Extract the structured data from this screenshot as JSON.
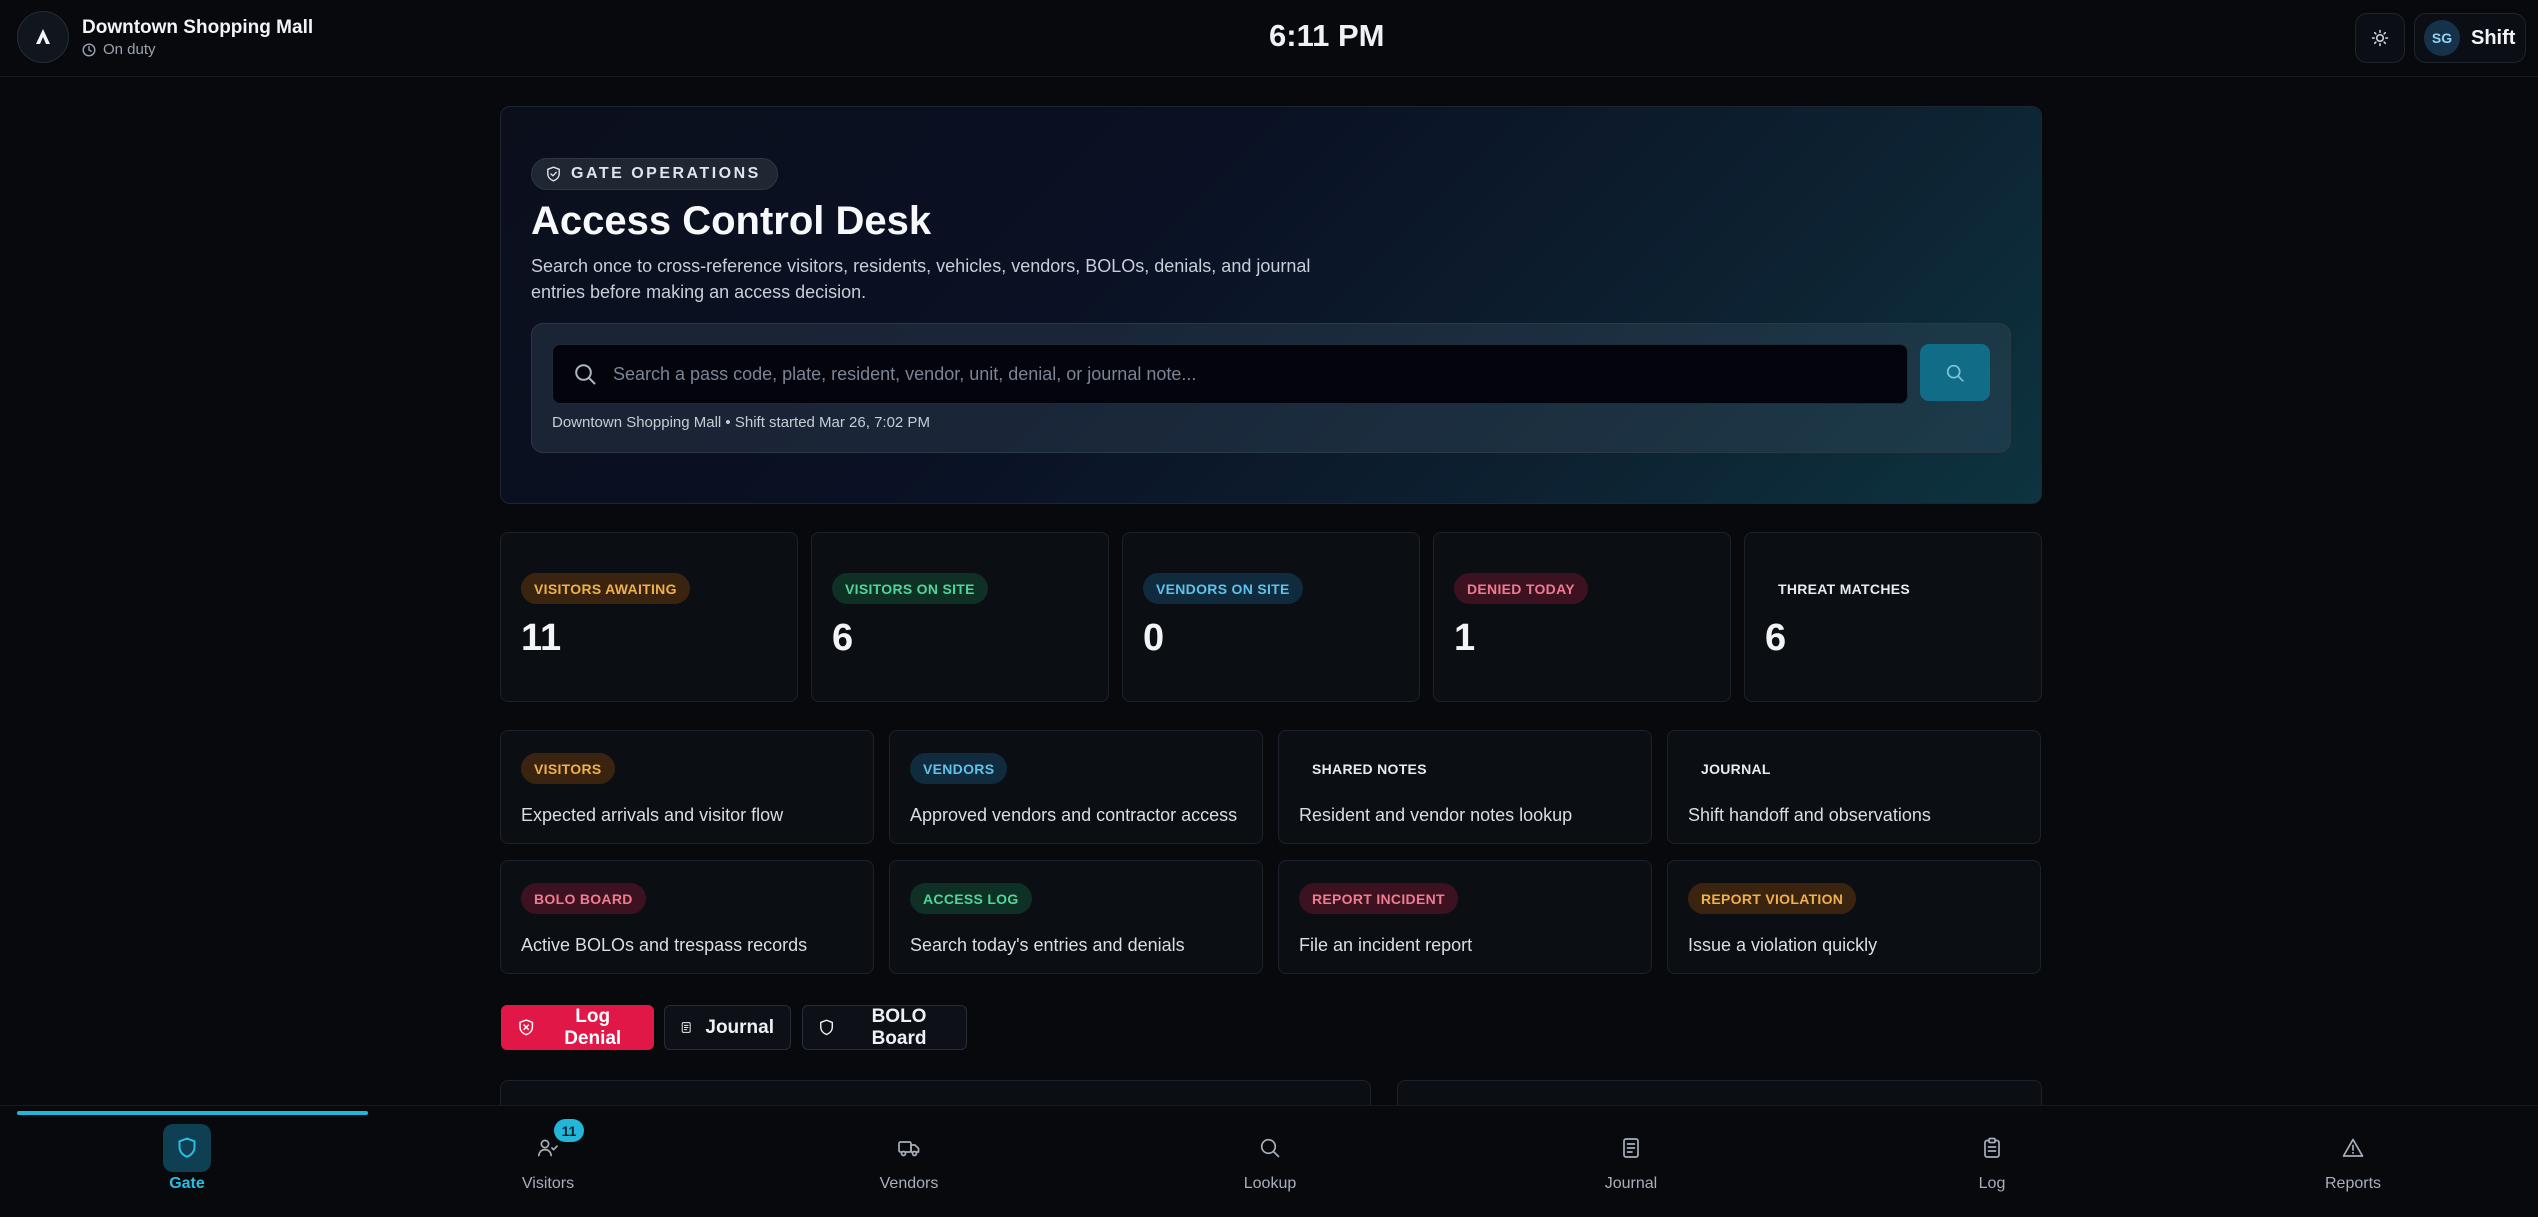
{
  "header": {
    "site_name": "Downtown Shopping Mall",
    "status": "On duty",
    "clock": "6:11 PM",
    "user_initials": "SG",
    "shift_label": "Shift"
  },
  "hero": {
    "badge": "GATE OPERATIONS",
    "title": "Access Control Desk",
    "description": "Search once to cross-reference visitors, residents, vehicles, vendors, BOLOs, denials, and journal entries before making an access decision.",
    "search_placeholder": "Search a pass code, plate, resident, vendor, unit, denial, or journal note...",
    "search_value": "",
    "meta": "Downtown Shopping Mall • Shift started Mar 26, 7:02 PM"
  },
  "stats": [
    {
      "label": "VISITORS AWAITING",
      "value": "11",
      "tone": "amber"
    },
    {
      "label": "VISITORS ON SITE",
      "value": "6",
      "tone": "green"
    },
    {
      "label": "VENDORS ON SITE",
      "value": "0",
      "tone": "blue"
    },
    {
      "label": "DENIED TODAY",
      "value": "1",
      "tone": "red"
    },
    {
      "label": "THREAT MATCHES",
      "value": "6",
      "tone": "plain"
    }
  ],
  "quick_links": [
    {
      "label": "VISITORS",
      "desc": "Expected arrivals and visitor flow",
      "tone": "amber"
    },
    {
      "label": "VENDORS",
      "desc": "Approved vendors and contractor access",
      "tone": "blue"
    },
    {
      "label": "SHARED NOTES",
      "desc": "Resident and vendor notes lookup",
      "tone": "plain"
    },
    {
      "label": "JOURNAL",
      "desc": "Shift handoff and observations",
      "tone": "plain"
    },
    {
      "label": "BOLO BOARD",
      "desc": "Active BOLOs and trespass records",
      "tone": "red"
    },
    {
      "label": "ACCESS LOG",
      "desc": "Search today's entries and denials",
      "tone": "green"
    },
    {
      "label": "REPORT INCIDENT",
      "desc": "File an incident report",
      "tone": "red"
    },
    {
      "label": "REPORT VIOLATION",
      "desc": "Issue a violation quickly",
      "tone": "amber"
    }
  ],
  "actions": {
    "log_denial": "Log Denial",
    "journal": "Journal",
    "bolo_board": "BOLO Board"
  },
  "nav": {
    "items": [
      {
        "label": "Gate",
        "icon": "shield-icon",
        "active": true
      },
      {
        "label": "Visitors",
        "icon": "users-icon",
        "badge": "11"
      },
      {
        "label": "Vendors",
        "icon": "truck-icon"
      },
      {
        "label": "Lookup",
        "icon": "search-icon"
      },
      {
        "label": "Journal",
        "icon": "notebook-icon"
      },
      {
        "label": "Log",
        "icon": "clipboard-icon"
      },
      {
        "label": "Reports",
        "icon": "alert-triangle-icon"
      }
    ],
    "progress": 0.14
  },
  "colors": {
    "accent": "#22b6d8",
    "danger": "#e11747",
    "background": "#07090d"
  }
}
